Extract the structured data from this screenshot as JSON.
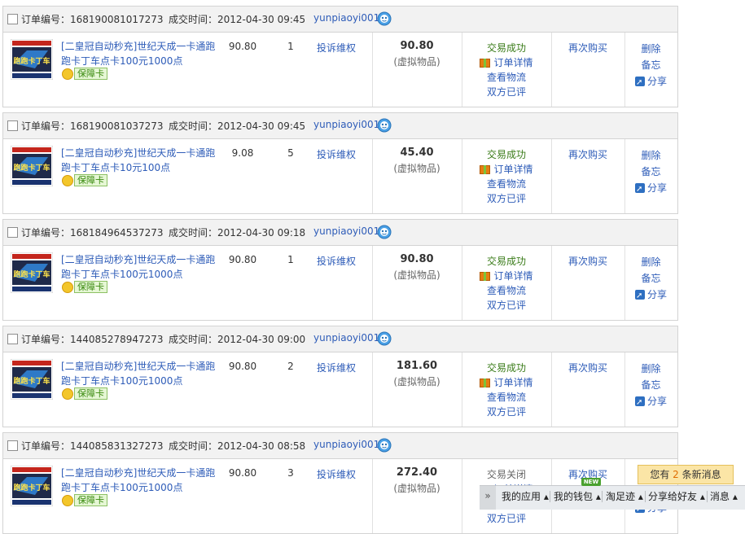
{
  "labels": {
    "order_no": "订单编号：",
    "deal_time": "成交时间：",
    "complain": "投诉维权",
    "virtual": "(虚拟物品)",
    "order_detail": "订单详情",
    "logistics": "查看物流",
    "both_rated": "双方已评",
    "rebuy": "再次购买",
    "delete": "删除",
    "memo": "备忘",
    "share": "分享",
    "guarantee": "保障卡",
    "thumb_text": "跑跑卡丁车"
  },
  "orders": [
    {
      "id": "168190081017273",
      "time": "2012-04-30 09:45",
      "seller": "yunpiaoyi001",
      "title": "[二皇冠自动秒充]世纪天成一卡通跑跑卡丁车点卡100元1000点",
      "price": "90.80",
      "qty": "1",
      "total": "90.80",
      "status": "交易成功"
    },
    {
      "id": "168190081037273",
      "time": "2012-04-30 09:45",
      "seller": "yunpiaoyi001",
      "title": "[二皇冠自动秒充]世纪天成一卡通跑跑卡丁车点卡10元100点",
      "price": "9.08",
      "qty": "5",
      "total": "45.40",
      "status": "交易成功"
    },
    {
      "id": "168184964537273",
      "time": "2012-04-30 09:18",
      "seller": "yunpiaoyi001",
      "title": "[二皇冠自动秒充]世纪天成一卡通跑跑卡丁车点卡100元1000点",
      "price": "90.80",
      "qty": "1",
      "total": "90.80",
      "status": "交易成功"
    },
    {
      "id": "144085278947273",
      "time": "2012-04-30 09:00",
      "seller": "yunpiaoyi001",
      "title": "[二皇冠自动秒充]世纪天成一卡通跑跑卡丁车点卡100元1000点",
      "price": "90.80",
      "qty": "2",
      "total": "181.60",
      "status": "交易成功"
    },
    {
      "id": "144085831327273",
      "time": "2012-04-30 08:58",
      "seller": "yunpiaoyi001",
      "title": "[二皇冠自动秒充]世纪天成一卡通跑跑卡丁车点卡100元1000点",
      "price": "90.80",
      "qty": "3",
      "total": "272.40",
      "status": "交易关闭"
    }
  ],
  "toolbar": {
    "expand": "»",
    "items": [
      "我的应用 ▴",
      "我的钱包 ▴",
      "淘足迹 ▴",
      "分享给好友 ▴",
      "消息 ▴"
    ],
    "new_badge": "NEW"
  },
  "message": {
    "prefix": "您有 ",
    "count": "2",
    "suffix": " 条新消息"
  },
  "colors": {
    "link": "#2e5cb8",
    "success": "#3b7c1a",
    "header_bg": "#f2f2f2",
    "message_count": "#e06d00"
  }
}
